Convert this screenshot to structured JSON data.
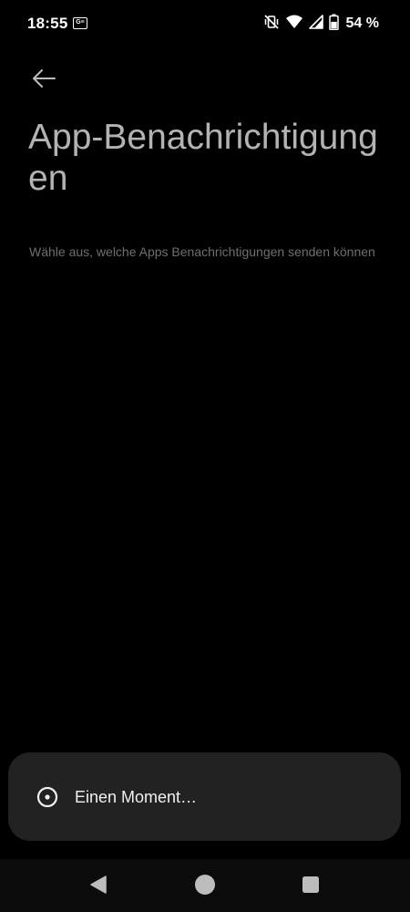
{
  "status_bar": {
    "time": "18:55",
    "notification_icon_label": "G≡",
    "battery_percent": "54 %",
    "icons": [
      "vibrate-off-icon",
      "wifi-icon",
      "signal-icon",
      "battery-icon"
    ],
    "battery_level": 0.54
  },
  "header": {
    "back_icon": "arrow-back-icon",
    "title": "App-Benachrichtigungen",
    "subtitle": "Wähle aus, welche Apps Benachrichtigungen senden können"
  },
  "toast": {
    "icon": "loading-icon",
    "message": "Einen Moment…"
  },
  "navigation": {
    "buttons": [
      "back-triangle-icon",
      "home-circle-icon",
      "recents-square-icon"
    ]
  },
  "colors": {
    "background": "#000000",
    "title": "#b3b3b3",
    "subtitle": "#6f6f6f",
    "toast_background": "#222222",
    "nav_icon": "#bdbdbd"
  }
}
